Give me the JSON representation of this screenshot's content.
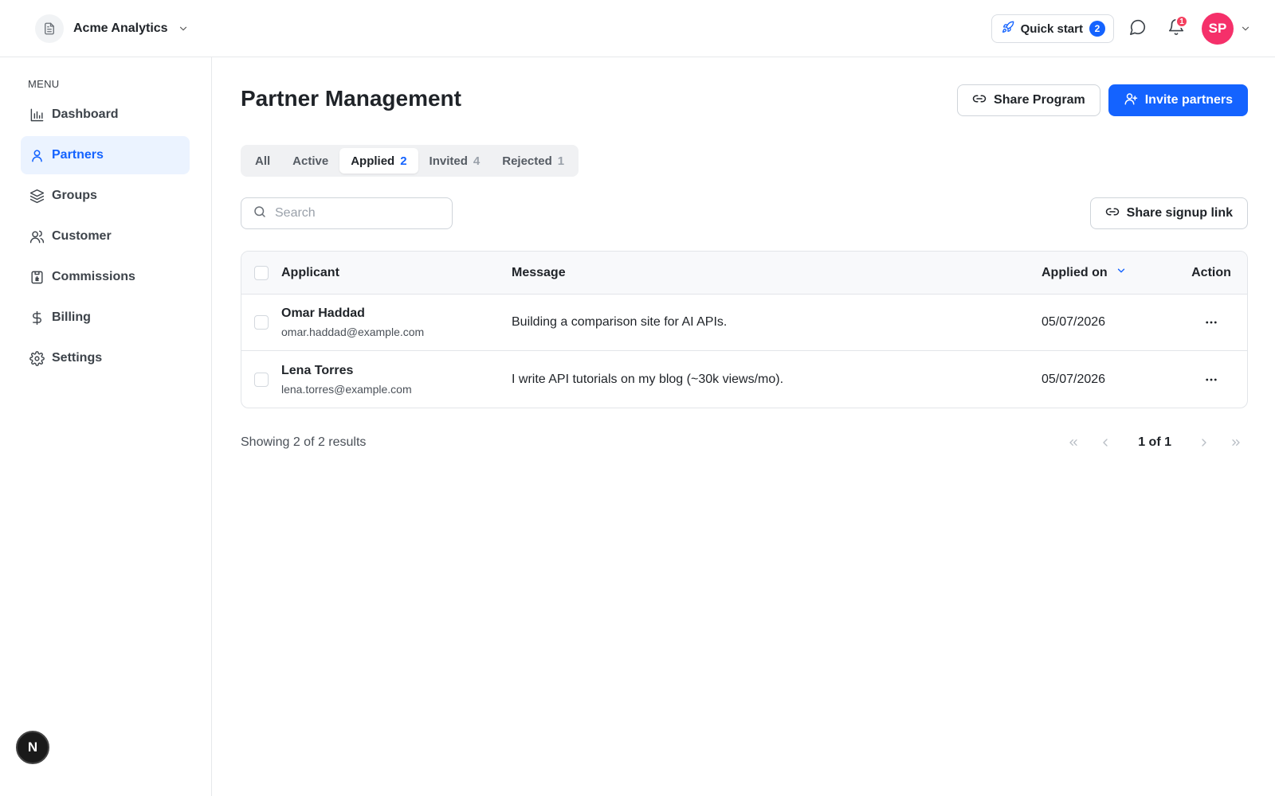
{
  "workspace": {
    "name": "Acme Analytics",
    "icon": "document-icon"
  },
  "topbar": {
    "quick_start_label": "Quick start",
    "quick_start_count": "2",
    "notifications_count": "1",
    "avatar_initials": "SP"
  },
  "sidebar": {
    "menu_label": "MENU",
    "items": [
      {
        "label": "Dashboard",
        "icon": "chart-icon"
      },
      {
        "label": "Partners",
        "icon": "user-icon",
        "active": true
      },
      {
        "label": "Groups",
        "icon": "layers-icon"
      },
      {
        "label": "Customer",
        "icon": "users-icon"
      },
      {
        "label": "Commissions",
        "icon": "receipt-icon"
      },
      {
        "label": "Billing",
        "icon": "dollar-icon"
      },
      {
        "label": "Settings",
        "icon": "gear-icon"
      }
    ],
    "badge_letter": "N"
  },
  "page": {
    "title": "Partner Management",
    "share_program_label": "Share Program",
    "invite_label": "Invite partners"
  },
  "tabs": [
    {
      "label": "All",
      "count": ""
    },
    {
      "label": "Active",
      "count": ""
    },
    {
      "label": "Applied",
      "count": "2",
      "active": true
    },
    {
      "label": "Invited",
      "count": "4"
    },
    {
      "label": "Rejected",
      "count": "1"
    }
  ],
  "search": {
    "placeholder": "Search",
    "value": ""
  },
  "share_signup_label": "Share signup link",
  "table": {
    "columns": {
      "applicant": "Applicant",
      "message": "Message",
      "applied_on": "Applied on",
      "action": "Action"
    },
    "rows": [
      {
        "name": "Omar Haddad",
        "email": "omar.haddad@example.com",
        "message": "Building a comparison site for AI APIs.",
        "applied_on": "05/07/2026"
      },
      {
        "name": "Lena Torres",
        "email": "lena.torres@example.com",
        "message": "I write API tutorials on my blog (~30k views/mo).",
        "applied_on": "05/07/2026"
      }
    ]
  },
  "footer": {
    "results_text": "Showing 2 of 2 results",
    "page_text": "1 of 1"
  },
  "colors": {
    "accent": "#1463ff",
    "avatar": "#f5306a",
    "notification": "#f43f5e",
    "active_nav_bg": "#ebf3ff"
  }
}
